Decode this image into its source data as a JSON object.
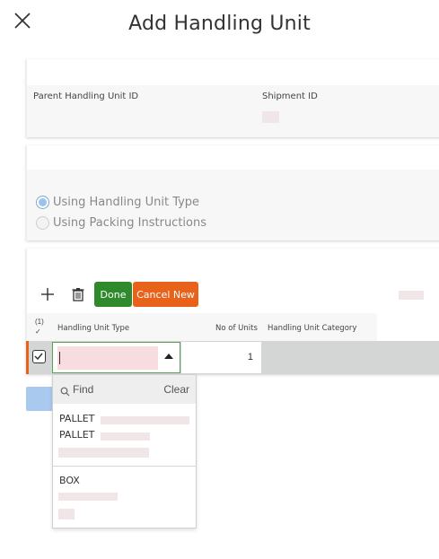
{
  "header": {
    "title": "Add Handling Unit",
    "close_icon": "close-icon"
  },
  "identity_section": {
    "parent_label": "Parent Handling Unit ID",
    "shipment_label": "Shipment ID"
  },
  "mode_section": {
    "options": [
      {
        "label": "Using Handling Unit Type",
        "selected": true
      },
      {
        "label": "Using Packing Instructions",
        "selected": false
      }
    ]
  },
  "lines_section": {
    "toolbar": {
      "add_icon": "plus-icon",
      "delete_icon": "trash-icon",
      "done_label": "Done",
      "cancel_new_label": "Cancel New"
    },
    "columns": {
      "count": "(1)",
      "check": "✓",
      "type": "Handling Unit Type",
      "units": "No of Units",
      "category": "Handling Unit Category"
    },
    "row": {
      "type_value": "",
      "units_value": "1"
    }
  },
  "dropdown": {
    "find_label": "Find",
    "clear_label": "Clear",
    "items": [
      {
        "lines": [
          "PALLET",
          "PALLET"
        ]
      },
      {
        "lines": [
          "BOX"
        ]
      }
    ]
  },
  "colors": {
    "done": "#2f8a2c",
    "cancel_new": "#e8621a",
    "input_focus_border": "#5aa15a",
    "row_background": "#d3d6d4"
  }
}
